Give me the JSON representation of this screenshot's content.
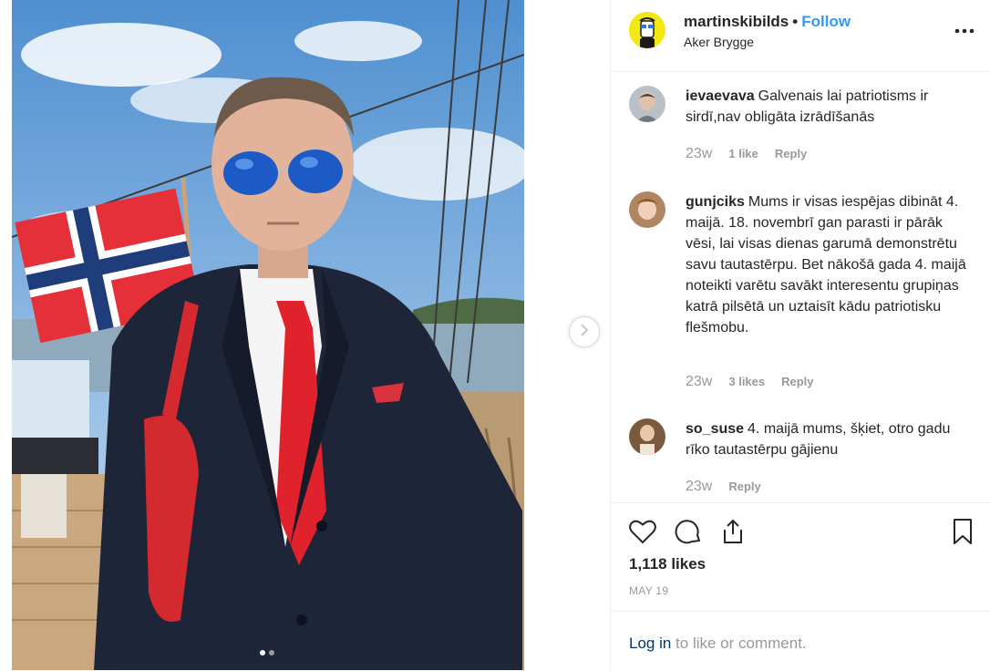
{
  "post": {
    "username": "martinskibilds",
    "follow_label": "Follow",
    "separator": "•",
    "location": "Aker Brygge",
    "more_label": "•••"
  },
  "comments": [
    {
      "username": "ievaevava",
      "text": "Galvenais lai patriotisms ir sirdī,nav obligāta izrādīšanās",
      "time": "23w",
      "likes": "1 like",
      "reply": "Reply"
    },
    {
      "username": "gunjciks",
      "text": "Mums ir visas iespējas dibināt 4. maijā. 18. novembrī gan parasti ir pārāk vēsi, lai visas dienas garumā demonstrētu savu tautastērpu. Bet nākošā gada 4. maijā noteikti varētu savākt interesentu grupiņas katrā pilsētā un uztaisīt kādu patriotisku flešmobu.",
      "time": "23w",
      "likes": "3 likes",
      "reply": "Reply"
    },
    {
      "username": "so_suse",
      "text": "4. maijā mums, šķiet, otro gadu rīko tautastērpu gājienu",
      "time": "23w",
      "likes": "",
      "reply": "Reply"
    }
  ],
  "stats": {
    "likes": "1,118 likes",
    "date": "MAY 19"
  },
  "login": {
    "link": "Log in",
    "rest": " to like or comment."
  },
  "carousel": {
    "next_icon": "chevron-right-icon",
    "dots": 2,
    "active": 0
  },
  "colors": {
    "link": "#3897f0",
    "muted": "#999999",
    "avatar_bg": "#f4e716"
  }
}
